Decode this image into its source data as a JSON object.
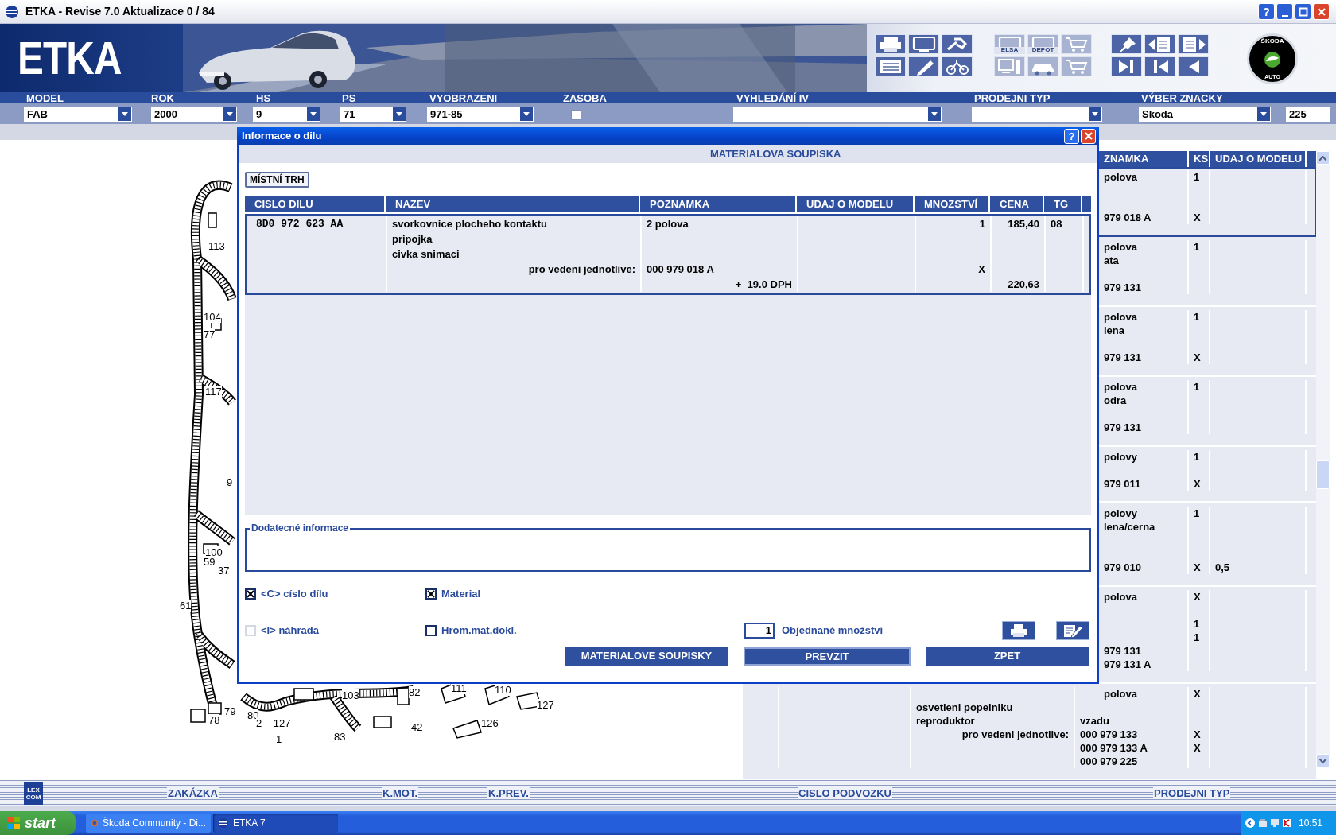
{
  "window": {
    "title": "ETKA - Revise 7.0 Aktualizace 0 / 84",
    "help": "?"
  },
  "banner": {
    "logo_text": "ETKA",
    "brand_logo": {
      "top": "ŠKODA",
      "bottom": "AUTO"
    },
    "toolbar": [
      {
        "disabled": false
      },
      {
        "disabled": false
      },
      {
        "disabled": false
      },
      {
        "disabled": false
      },
      {
        "disabled": false
      },
      {
        "disabled": false
      },
      {
        "disabled": true,
        "label": "ELSA"
      },
      {
        "disabled": true,
        "label": "DEPOT"
      },
      {
        "disabled": true
      },
      {
        "disabled": true
      },
      {
        "disabled": true
      },
      {
        "disabled": true
      },
      {
        "disabled": false
      },
      {
        "disabled": false
      },
      {
        "disabled": false
      },
      {
        "disabled": false
      },
      {
        "disabled": false
      },
      {
        "disabled": false
      }
    ]
  },
  "filters": [
    {
      "label": "MODEL",
      "kind": "dropdown",
      "value": "FAB"
    },
    {
      "label": "ROK",
      "kind": "dropdown",
      "value": "2000"
    },
    {
      "label": "HS",
      "kind": "dropdown",
      "value": "9"
    },
    {
      "label": "PS",
      "kind": "dropdown",
      "value": "71"
    },
    {
      "label": "VYOBRAZENI",
      "kind": "dropdown",
      "value": "971-85"
    },
    {
      "label": "ZASOBA",
      "kind": "checkbox",
      "checked": false
    },
    {
      "label": "VYHLEDÁNÍ IV",
      "kind": "dropdown"
    },
    {
      "label": "PRODEJNI TYP",
      "kind": "dropdown"
    },
    {
      "label": "VÝBER ZNACKY",
      "kind": "dropdown",
      "value": "Skoda"
    }
  ],
  "count": "225",
  "diagram": {
    "callouts": [
      "113",
      "104",
      "77",
      "117",
      "9",
      "100",
      "59",
      "37",
      "61",
      "78",
      "79",
      "80",
      "2 – 127",
      "1",
      "83",
      "103",
      "82",
      "42",
      "111",
      "110",
      "127",
      "126"
    ]
  },
  "parts_table": {
    "columns": [
      "ZNAMKA",
      "KS",
      "UDAJ O MODELU"
    ],
    "rows": [
      {
        "selected": true,
        "lines": [
          {
            "poznamka": "polova",
            "ks": "1",
            "cut": true
          },
          {
            "kind": "blank"
          },
          {
            "kind": "blank"
          },
          {
            "poznamka": "979 018 A",
            "ks": "X",
            "cut": true
          }
        ]
      },
      {
        "selected": false,
        "lines": [
          {
            "poznamka": "polova",
            "ks": "1",
            "cut": true
          },
          {
            "poznamka": "ata",
            "cut": true
          },
          {
            "kind": "blank"
          },
          {
            "poznamka": "979 131",
            "cut": true
          }
        ]
      },
      {
        "selected": false,
        "lines": [
          {
            "poznamka": "polova",
            "ks": "1",
            "cut": true
          },
          {
            "poznamka": "lena",
            "cut": true
          },
          {
            "kind": "blank"
          },
          {
            "poznamka": "979 131",
            "ks": "X",
            "cut": true
          }
        ]
      },
      {
        "selected": false,
        "lines": [
          {
            "poznamka": "polova",
            "ks": "1",
            "cut": true
          },
          {
            "poznamka": "odra",
            "cut": true
          },
          {
            "kind": "blank"
          },
          {
            "poznamka": "979 131",
            "cut": true
          }
        ]
      },
      {
        "selected": false,
        "lines": [
          {
            "poznamka": "polovy",
            "ks": "1",
            "cut": true
          },
          {
            "kind": "blank"
          },
          {
            "poznamka": "979 011",
            "ks": "X",
            "cut": true
          }
        ]
      },
      {
        "selected": false,
        "lines": [
          {
            "poznamka": "polovy",
            "ks": "1",
            "cut": true
          },
          {
            "poznamka": "lena/cerna",
            "cut": true
          },
          {
            "kind": "blank"
          },
          {
            "kind": "blank"
          },
          {
            "poznamka": "979 010",
            "ks": "X",
            "udaj": "0,5",
            "cut": true
          }
        ]
      },
      {
        "selected": false,
        "lines": [
          {
            "poznamka": "polova",
            "ks": "X",
            "cut": true
          },
          {
            "kind": "blank"
          },
          {
            "ks": "1"
          },
          {
            "ks": "1"
          },
          {
            "poznamka": "979 131",
            "cut": true
          },
          {
            "poznamka": "979 131 A",
            "cut": true
          }
        ]
      },
      {
        "selected": false,
        "lines": [
          {
            "poznamka": "polova",
            "ks": "X",
            "cut": true
          },
          {
            "nazev": "osvetleni popelniku"
          },
          {
            "nazev": "reproduktor",
            "poznamka": "vzadu"
          },
          {
            "nazev": "pro vedeni jednotlive:",
            "poznamka": "000 979 133",
            "ks": "X",
            "kind": "note"
          },
          {
            "poznamka": "000 979 133 A",
            "ks": "X"
          },
          {
            "poznamka": "000 979 225"
          }
        ]
      }
    ]
  },
  "dialog": {
    "title": "Informace o dilu",
    "help": "?",
    "heading": "MATERIALOVA SOUPISKA",
    "market_button": "MÍSTNÍ TRH",
    "columns": [
      "CISLO DILU",
      "NAZEV",
      "POZNAMKA",
      "UDAJ O MODELU",
      "MNOZSTVÍ",
      "CENA",
      "TG"
    ],
    "rows": [
      {
        "selected": true,
        "lines": [
          {
            "kind": "main",
            "cislo": "8D0 972 623 AA",
            "nazev": "svorkovnice plocheho kontaktu",
            "poznamka": "2 polova",
            "mnozstvi": "1",
            "cena": "185,40",
            "tg": "08"
          },
          {
            "kind": "text",
            "nazev": "pripojka"
          },
          {
            "kind": "text",
            "nazev": "civka snimaci"
          },
          {
            "kind": "note",
            "nazev": "pro vedeni jednotlive:",
            "poznamka": "000 979 018 A",
            "mnozstvi": "X"
          },
          {
            "kind": "tax",
            "poznamka": "+  19.0 DPH",
            "cena": "220,63"
          }
        ]
      }
    ],
    "info_label": "Dodatecné informace",
    "options": [
      {
        "label": "<C> císlo dílu",
        "checked": true,
        "disabled": false
      },
      {
        "label": "Material",
        "checked": true,
        "disabled": false
      },
      {
        "label": "<I> náhrada",
        "checked": false,
        "disabled": true
      },
      {
        "label": "Hrom.mat.dokl.",
        "checked": false,
        "disabled": false
      }
    ],
    "quantity": {
      "value": "1",
      "label": "Objednané množství"
    },
    "buttons": [
      {
        "label": "MATERIALOVE SOUPISKY",
        "focused": false
      },
      {
        "label": "PREVZIT",
        "focused": true
      },
      {
        "label": "ZPET",
        "focused": false
      }
    ]
  },
  "bottom_bar": {
    "logo": [
      "LEX",
      "COM"
    ],
    "fields": [
      "ZAKÁZKA",
      "K.MOT.",
      "K.PREV.",
      "CISLO PODVOZKU",
      "PRODEJNI TYP"
    ]
  },
  "taskbar": {
    "start": "start",
    "tasks": [
      {
        "label": "Škoda Community - Di...",
        "selected": false
      },
      {
        "label": "ETKA 7",
        "selected": true
      }
    ],
    "clock": "10:51"
  }
}
